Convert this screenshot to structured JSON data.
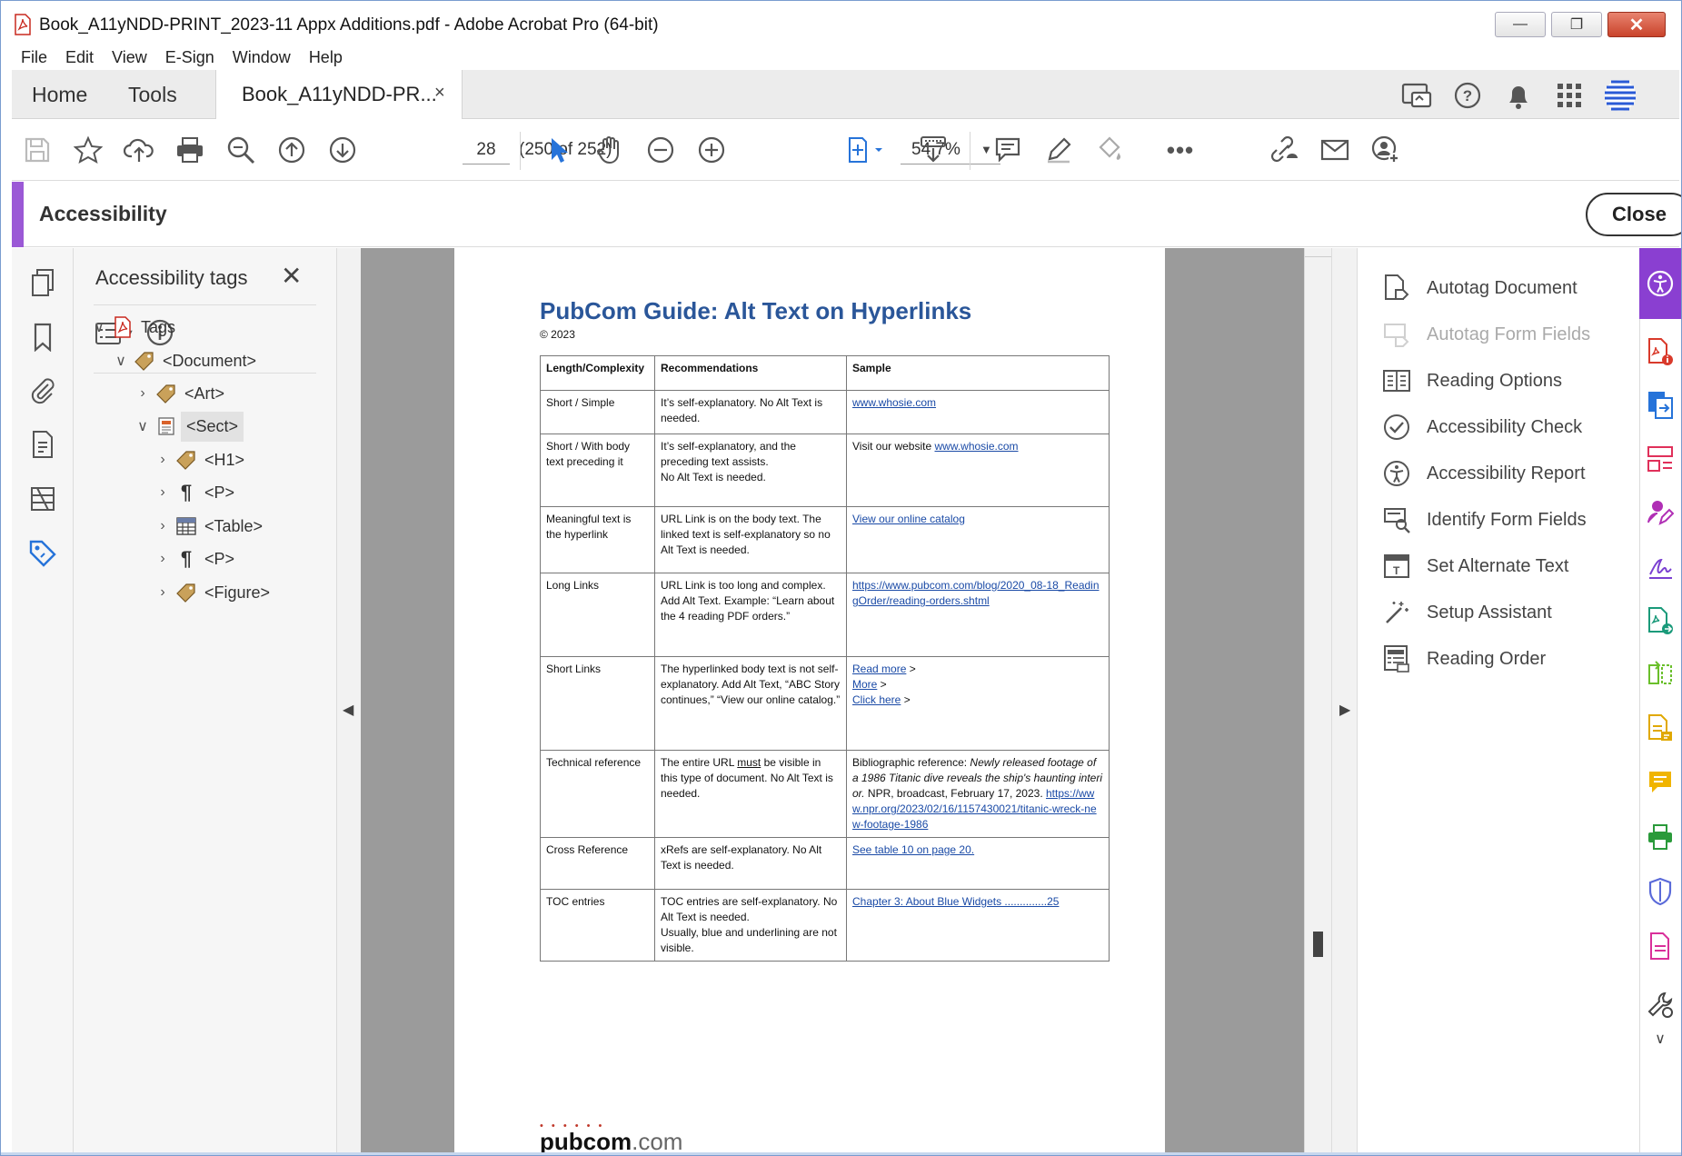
{
  "window": {
    "title": "Book_A11yNDD-PRINT_2023-11 Appx Additions.pdf - Adobe Acrobat Pro (64-bit)",
    "controls": [
      "minimize",
      "restore",
      "close"
    ]
  },
  "menu": [
    "File",
    "Edit",
    "View",
    "E-Sign",
    "Window",
    "Help"
  ],
  "tabs": {
    "home": "Home",
    "tools": "Tools",
    "document": "Book_A11yNDD-PR...",
    "document_close": "×"
  },
  "top_icons": [
    "share-screen-icon",
    "help-icon",
    "bell-icon",
    "apps-grid-icon",
    "adobe-profile-icon"
  ],
  "toolbar": {
    "page_current": "28",
    "page_count": "(250 of 252)",
    "zoom": "54.7%"
  },
  "accessibility": {
    "title": "Accessibility",
    "close_label": "Close"
  },
  "tags_panel": {
    "title": "Accessibility tags",
    "tree": [
      {
        "label": "Tags",
        "level": 0,
        "expanded": true,
        "icon": "pdf-tag-root-icon"
      },
      {
        "label": "<Document>",
        "level": 1,
        "expanded": true,
        "icon": "tag-icon"
      },
      {
        "label": "<Art>",
        "level": 2,
        "expanded": false,
        "icon": "tag-icon"
      },
      {
        "label": "<Sect>",
        "level": 2,
        "expanded": true,
        "icon": "section-icon",
        "selected": true
      },
      {
        "label": "<H1>",
        "level": 3,
        "expanded": false,
        "icon": "tag-icon"
      },
      {
        "label": "<P>",
        "level": 3,
        "expanded": false,
        "icon": "paragraph-icon"
      },
      {
        "label": "<Table>",
        "level": 3,
        "expanded": false,
        "icon": "table-icon"
      },
      {
        "label": "<P>",
        "level": 3,
        "expanded": false,
        "icon": "paragraph-icon"
      },
      {
        "label": "<Figure>",
        "level": 3,
        "expanded": false,
        "icon": "tag-icon"
      }
    ]
  },
  "page": {
    "title": "PubCom Guide: Alt Text on Hyperlinks",
    "copyright": "© 2023",
    "table": {
      "headers": [
        "Length/Complexity",
        "Recommendations",
        "Sample"
      ],
      "rows": [
        {
          "length": "Short / Simple",
          "rec": "It’s self-explanatory. No Alt Text is needed.",
          "sample_html": "<span class='lnk'>www.whosie.com</span>"
        },
        {
          "length": "Short / With body text preceding it",
          "rec": "It’s self-explanatory, and the preceding text assists.<br>No Alt Text is needed.",
          "sample_html": "Visit our website <span class='lnk'>www.whosie.com</span>"
        },
        {
          "length": "Meaningful text is the hyperlink",
          "rec": "URL Link is on the body text. The linked text is self-explanatory so no Alt Text is needed.",
          "sample_html": "<span class='lnk'>View our online catalog</span>"
        },
        {
          "length": "Long Links",
          "rec": "URL Link is too long and complex. Add Alt Text. Example: “Learn about the 4 reading PDF orders.”",
          "sample_html": "<span class='lnk'>https://www.pubcom.com/blog/2020_08-18_ReadingOrder/reading-orders.shtml</span>"
        },
        {
          "length": "Short Links",
          "rec": "The hyperlinked body text is not self-explanatory. Add Alt Text, “ABC Story continues,” “View our online catalog.”",
          "sample_html": "<span class='lnk'>Read more</span> &gt;<br><span class='lnk'>More</span> &gt;<br><span class='lnk'>Click here</span> &gt;"
        },
        {
          "length": "Technical reference",
          "rec": "The entire URL <u>must</u> be visible in this type of document. No Alt Text is needed.",
          "sample_html": "Bibliographic reference: <i>Newly released footage of a 1986 Titanic dive reveals the ship's haunting interior.</i>  NPR, broadcast, February 17, 2023. <span class='lnk'>https://www.npr.org/2023/02/16/1157430021/titanic-wreck-new-footage-1986</span>"
        },
        {
          "length": "Cross Reference",
          "rec": "xRefs are self-explanatory. No Alt Text is needed.",
          "sample_html": "<span class='lnk'>See table 10 on page 20.</span>"
        },
        {
          "length": "TOC entries",
          "rec": "TOC entries are  self-explanatory. No Alt Text is needed.<br>Usually, blue and underlining are not visible.",
          "sample_html": "<span class='lnk'>Chapter 3: About Blue Widgets ..............25</span>"
        }
      ]
    },
    "logo_main": "pubcom",
    "logo_suffix": ".com"
  },
  "right_panel": {
    "items": [
      {
        "label": "Autotag Document",
        "icon": "autotag-document-icon",
        "disabled": false
      },
      {
        "label": "Autotag Form Fields",
        "icon": "autotag-form-fields-icon",
        "disabled": true
      },
      {
        "label": "Reading Options",
        "icon": "reading-options-icon",
        "disabled": false
      },
      {
        "label": "Accessibility Check",
        "icon": "accessibility-check-icon",
        "disabled": false
      },
      {
        "label": "Accessibility Report",
        "icon": "accessibility-report-icon",
        "disabled": false
      },
      {
        "label": "Identify Form Fields",
        "icon": "identify-form-fields-icon",
        "disabled": false
      },
      {
        "label": "Set Alternate Text",
        "icon": "set-alternate-text-icon",
        "disabled": false
      },
      {
        "label": "Setup Assistant",
        "icon": "setup-assistant-icon",
        "disabled": false
      },
      {
        "label": "Reading Order",
        "icon": "reading-order-icon",
        "disabled": false
      }
    ]
  },
  "colors": {
    "accent_purple": "#8a3fd1",
    "heading_blue": "#2a5699",
    "link_blue": "#1a4aa6",
    "toolbar_blue": "#2673d9"
  }
}
